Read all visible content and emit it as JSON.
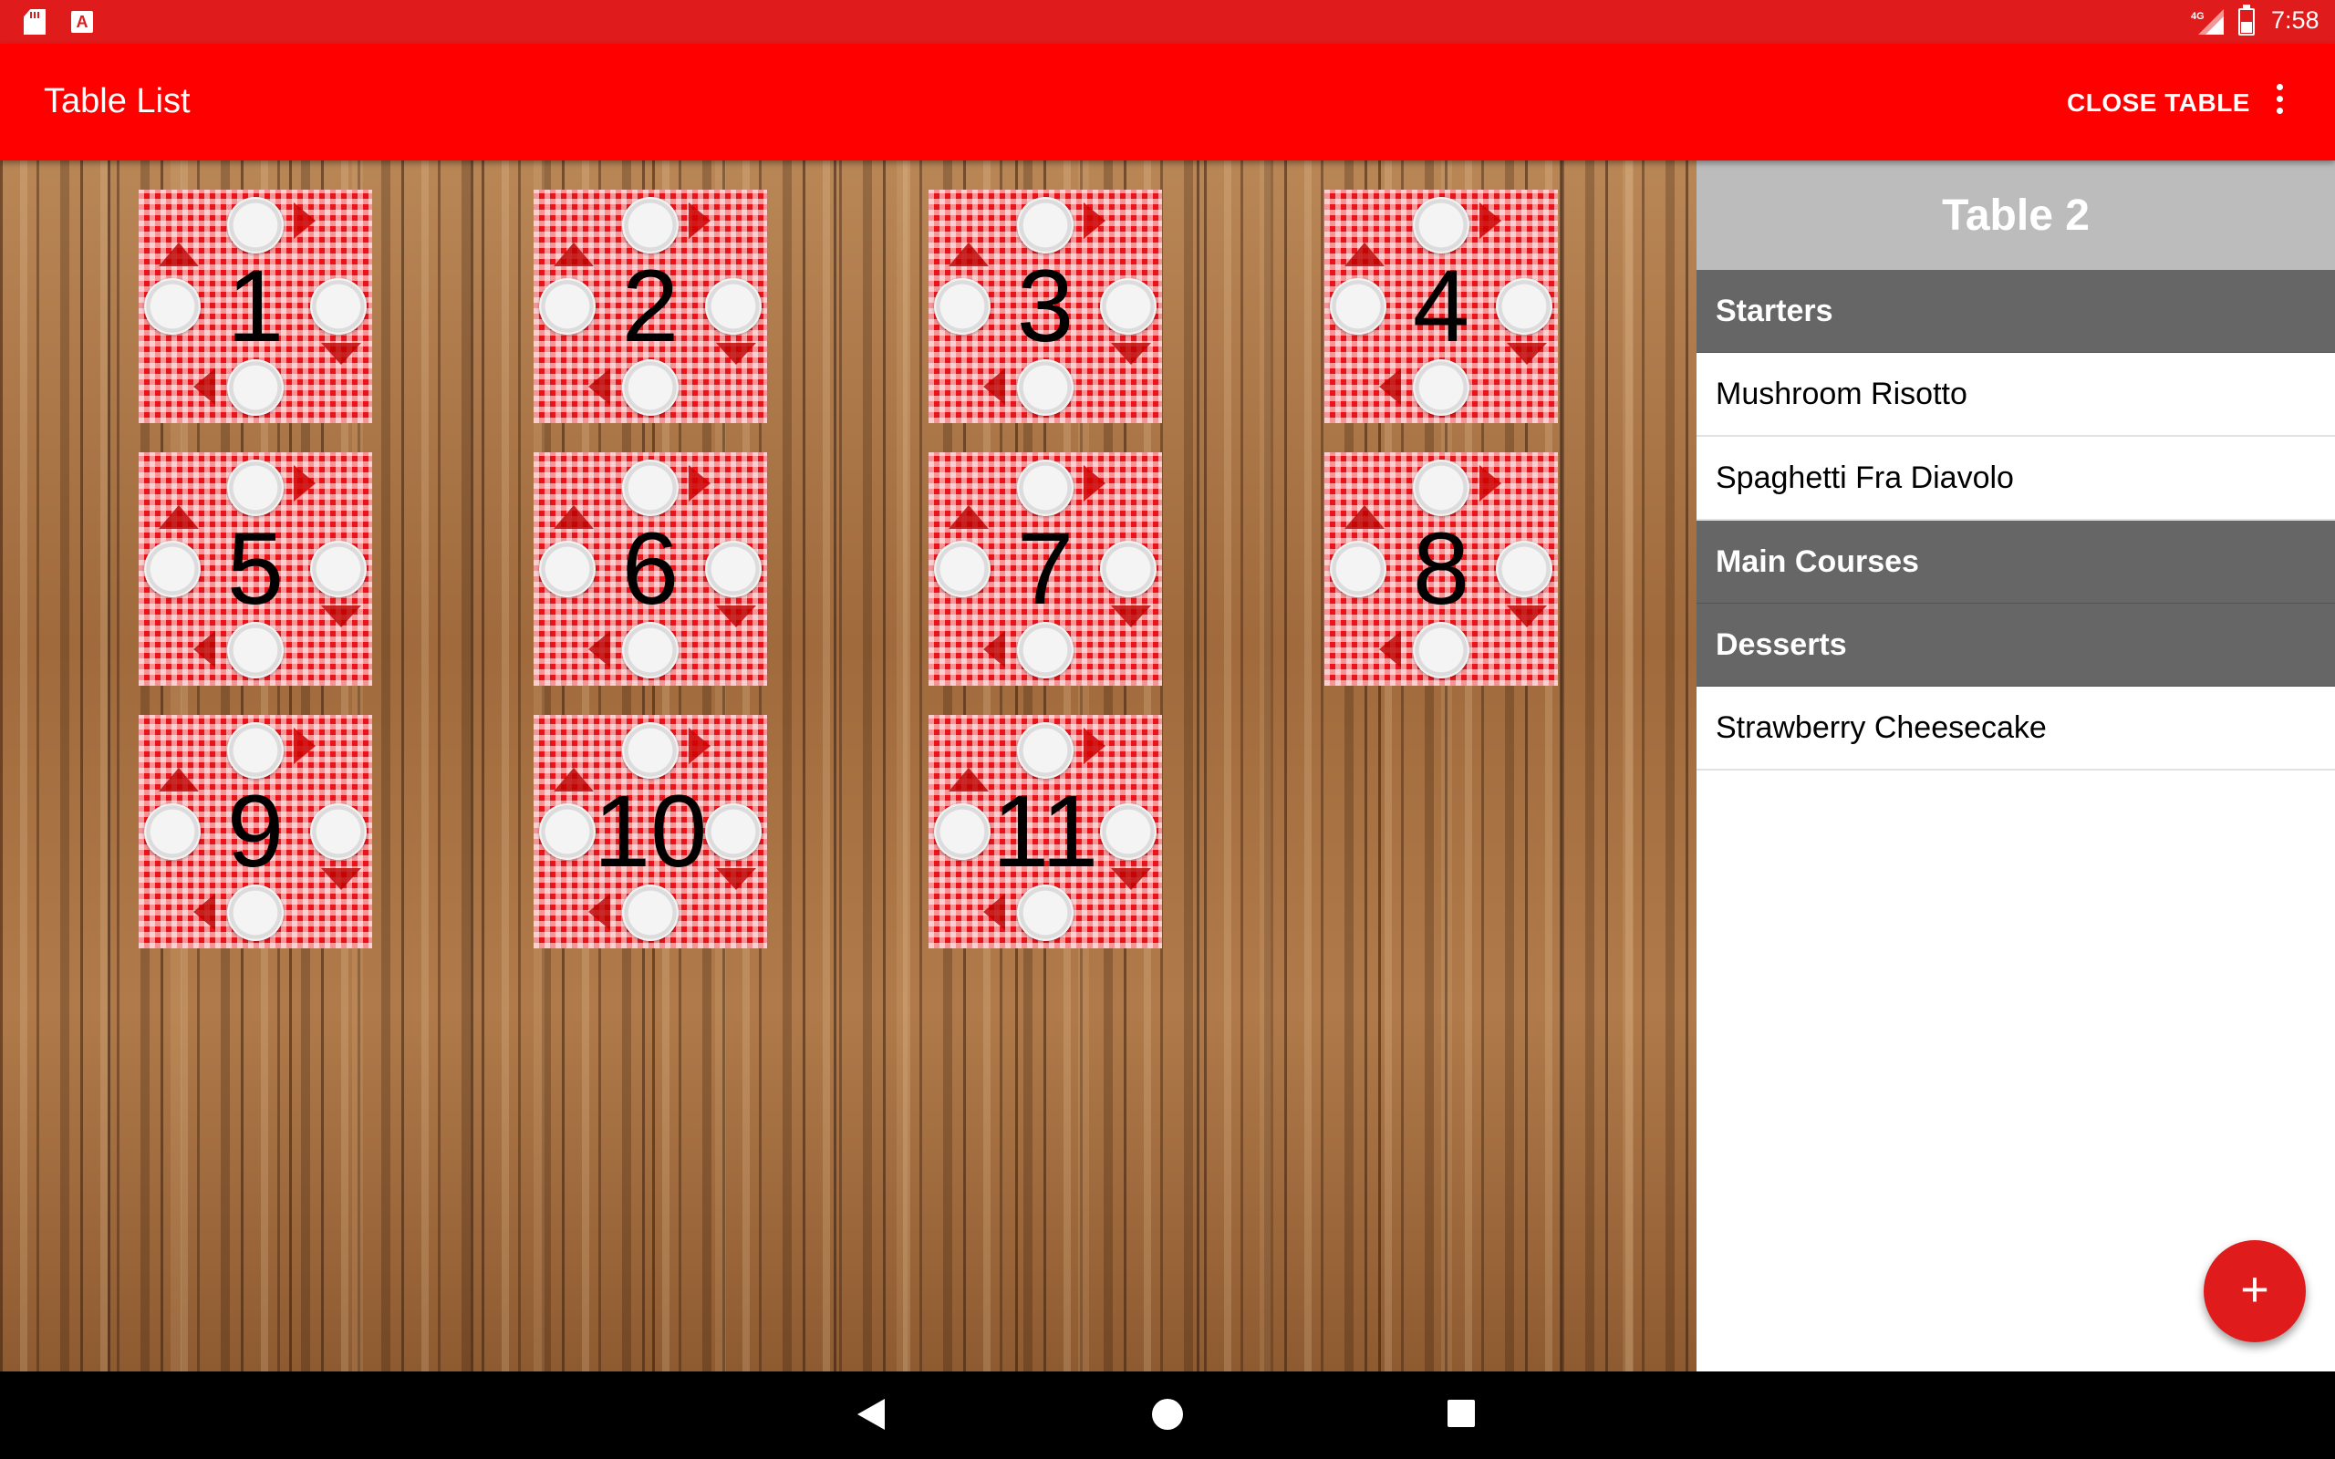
{
  "status_bar": {
    "time": "7:58",
    "network_label": "4G",
    "icons": [
      "sd-card-icon",
      "text-a-icon",
      "signal-4g-icon",
      "battery-icon"
    ]
  },
  "app_bar": {
    "title": "Table List",
    "close_table_label": "CLOSE TABLE",
    "overflow_icon": "more-vert-icon"
  },
  "tables": [
    {
      "number": "1"
    },
    {
      "number": "2"
    },
    {
      "number": "3"
    },
    {
      "number": "4"
    },
    {
      "number": "5"
    },
    {
      "number": "6"
    },
    {
      "number": "7"
    },
    {
      "number": "8"
    },
    {
      "number": "9"
    },
    {
      "number": "10"
    },
    {
      "number": "11"
    }
  ],
  "order_panel": {
    "title": "Table 2",
    "sections": [
      {
        "label": "Starters",
        "items": [
          "Mushroom Risotto",
          "Spaghetti Fra Diavolo"
        ]
      },
      {
        "label": "Main Courses",
        "items": []
      },
      {
        "label": "Desserts",
        "items": [
          "Strawberry Cheesecake"
        ]
      }
    ],
    "fab_symbol": "+"
  },
  "nav_bar": {
    "icons": [
      "back-icon",
      "home-icon",
      "recents-icon"
    ]
  },
  "colors": {
    "status_bar": "#e01b1b",
    "app_bar": "#ff0000",
    "panel_header": "#bcbcbc",
    "section_header": "#666666",
    "fab": "#e01b1b"
  }
}
